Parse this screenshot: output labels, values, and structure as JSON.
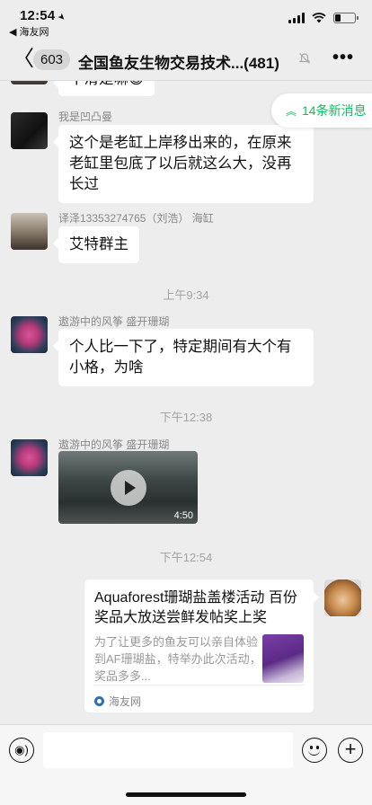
{
  "status_bar": {
    "time": "12:54",
    "location_arrow": "➤",
    "back_to_app": "◀ 海友网"
  },
  "nav": {
    "back_glyph": "〈",
    "unread_count": "603",
    "title": "全国鱼友生物交易技术...",
    "member_count": "(481)",
    "mute_icon": "mute-icon",
    "more_glyph": "•••"
  },
  "new_messages": {
    "chevron": "︽",
    "label": "14条新消息"
  },
  "messages": [
    {
      "sender": "",
      "text": "不滑是嘛😅"
    },
    {
      "sender": "我是凹凸曼",
      "text": "这个是老缸上岸移出来的，在原来老缸里包底了以后就这么大，没再长过"
    },
    {
      "sender": "译泽13353274765（刘浩） 海缸",
      "text": "艾特群主"
    },
    {
      "time": "上午9:34"
    },
    {
      "sender": "遨游中的风筝 盛开珊瑚",
      "text": "个人比一下了，特定期间有大个有小格，为啥"
    },
    {
      "time": "下午12:38"
    },
    {
      "sender": "遨游中的风筝 盛开珊瑚",
      "video_duration": "4:50"
    },
    {
      "time": "下午12:54"
    },
    {
      "link": {
        "title": "Aquaforest珊瑚盐盖楼活动 百份奖品大放送尝鲜发帖奖上奖",
        "desc": "为了让更多的鱼友可以亲自体验到AF珊瑚盐，特举办此次活动，奖品多多...",
        "source": "海友网"
      }
    }
  ],
  "input_bar": {
    "voice_glyph": "◉)",
    "plus_glyph": "+"
  },
  "colors": {
    "background": "#ededed",
    "accent_green": "#07c160",
    "bubble": "#ffffff",
    "timestamp": "#a3a3a3"
  }
}
